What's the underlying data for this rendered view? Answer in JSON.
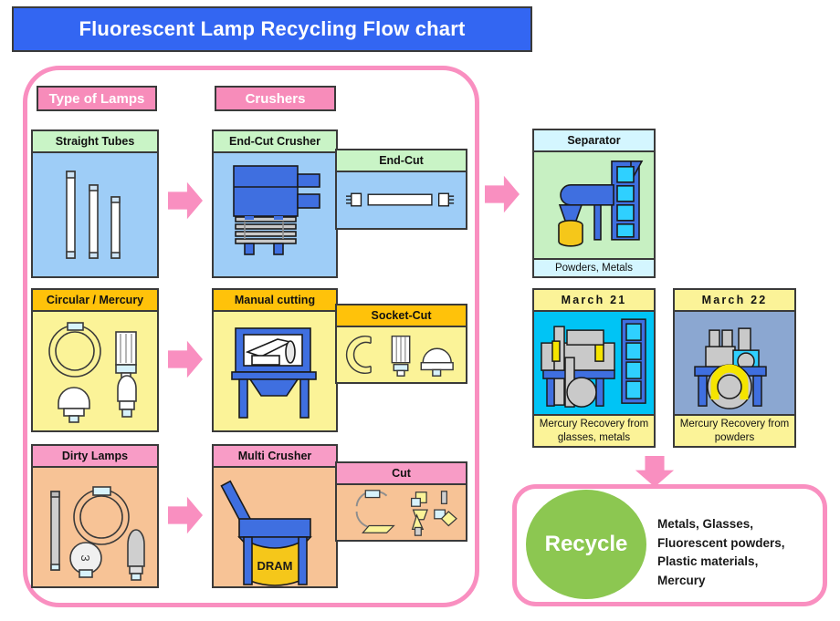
{
  "title": {
    "text": "Fluorescent Lamp Recycling Flow chart"
  },
  "columns": {
    "type_of_lamps": "Type of Lamps",
    "crushers": "Crushers"
  },
  "panels": {
    "straight_tubes": {
      "caption": "Straight Tubes"
    },
    "end_cut_crusher": {
      "caption": "End-Cut Crusher"
    },
    "end_cut": {
      "caption": "End-Cut"
    },
    "circular_mercury": {
      "caption": "Circular / Mercury"
    },
    "manual_cutting": {
      "caption": "Manual cutting"
    },
    "socket_cut": {
      "caption": "Socket-Cut"
    },
    "dirty_lamps": {
      "caption": "Dirty Lamps"
    },
    "multi_crusher": {
      "caption": "Multi Crusher",
      "drum_label": "DRAM"
    },
    "cut": {
      "caption": "Cut"
    },
    "separator": {
      "caption": "Separator",
      "footer": "Powders, Metals"
    },
    "march21": {
      "caption": "March 21",
      "footer": "Mercury Recovery from glasses, metals"
    },
    "march22": {
      "caption": "March 22",
      "footer": "Mercury Recovery from powders"
    }
  },
  "recycle": {
    "label": "Recycle",
    "outputs": "Metals,  Glasses,\nFluorescent powders,\nPlastic materials,\nMercury"
  },
  "colors": {
    "title_bg": "#3366f2",
    "pink_frame": "#f98fc0",
    "chip_pink": "#f78cba",
    "cap_green": "#c9f4c6",
    "cap_amber": "#ffc20a",
    "cap_pink": "#f89cc6",
    "cap_cyan": "#d4f6ff",
    "cap_yellow": "#fbf398",
    "body_blue": "#9ecdf7",
    "body_yellow": "#fbf398",
    "body_peach": "#f7c396",
    "body_mint": "#c7f0c2",
    "body_cyan": "#00c4f5",
    "body_steel": "#8ba7d1",
    "recycle_green": "#8cc751",
    "machine_blue": "#3f6fe0",
    "outline": "#3a3a3a"
  }
}
